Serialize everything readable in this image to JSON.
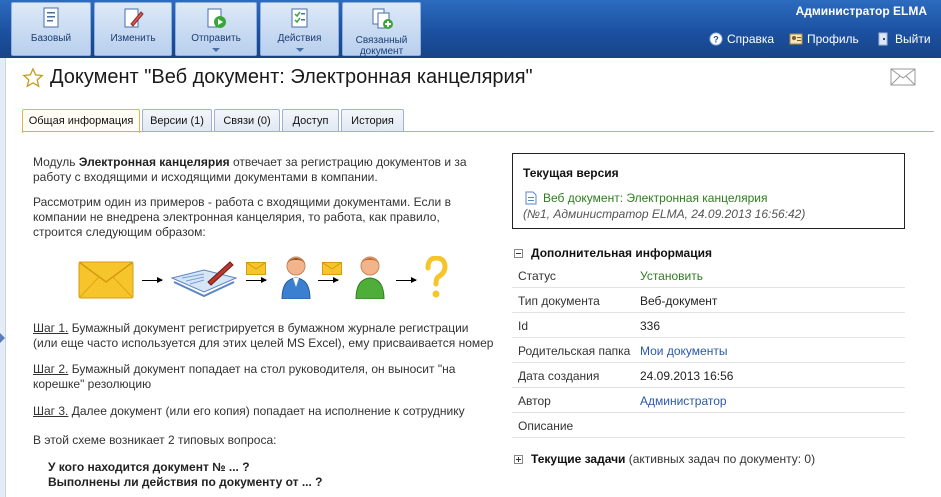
{
  "toolbar": {
    "buttons": [
      {
        "label": "Базовый",
        "icon": "base-document-icon"
      },
      {
        "label": "Изменить",
        "icon": "edit-icon"
      },
      {
        "label": "Отправить",
        "icon": "send-icon",
        "dropdown": true
      },
      {
        "label": "Действия",
        "icon": "actions-icon",
        "dropdown": true
      },
      {
        "label": "Связанный документ",
        "label_lines": [
          "Связанный",
          "документ"
        ],
        "icon": "linked-document-icon"
      }
    ],
    "user_name": "Администратор ELMA",
    "links": {
      "help": "Справка",
      "profile": "Профиль",
      "logout": "Выйти"
    }
  },
  "page": {
    "title": "Документ \"Веб документ: Электронная канцелярия\""
  },
  "tabs": [
    {
      "label": "Общая информация",
      "active": true
    },
    {
      "label": "Версии (1)"
    },
    {
      "label": "Связи (0)"
    },
    {
      "label": "Доступ"
    },
    {
      "label": "История"
    }
  ],
  "content": {
    "p1_prefix": "Модуль ",
    "p1_bold": "Электронная канцелярия",
    "p1_rest_line1": " отвечает за регистрацию документов и за",
    "p1_line2": "работу с входящими и исходящими документами в компании.",
    "p2_line1": "Рассмотрим один из примеров - работа с входящими документами. Если в",
    "p2_line2": "компании не внедрена электронная канцелярия, то работа, как правило,",
    "p2_line3": "строится следующим образом:",
    "step1_label": "Шаг 1.",
    "step1_line1": " Бумажный документ регистрируется в бумажном журнале регистрации",
    "step1_line2": "(или еще часто используется для этих целей MS Excel), ему присваивается номер",
    "step2_label": "Шаг 2.",
    "step2_line1": " Бумажный документ попадает на стол руководителя, он выносит \"на",
    "step2_line2": "корешке\" резолюцию",
    "step3_label": "Шаг 3.",
    "step3_line1": " Далее документ (или его копия) попадает на исполнение к сотруднику",
    "p3": "В этой схеме возникает 2 типовых вопроса:",
    "q1": "У кого находится документ № ... ?",
    "q2": "Выполнены ли действия по документу от ... ?"
  },
  "current_version": {
    "title": "Текущая версия",
    "link": "Веб документ: Электронная канцелярия",
    "meta": "(№1, Администратор ELMA, 24.09.2013 16:56:42)"
  },
  "additional_info": {
    "title": "Дополнительная информация",
    "rows": [
      {
        "key": "Статус",
        "value": "Установить"
      },
      {
        "key": "Тип документа",
        "value": "Веб-документ"
      },
      {
        "key": "Id",
        "value": "336"
      },
      {
        "key": "Родительская папка",
        "value": "Мои документы"
      },
      {
        "key": "Дата создания",
        "value": "24.09.2013 16:56"
      },
      {
        "key": "Автор",
        "value": "Администратор"
      },
      {
        "key": "Описание",
        "value": ""
      }
    ]
  },
  "tasks": {
    "title": "Текущие задачи",
    "note": " (активных задач по документу: 0)"
  },
  "colors": {
    "toolbar": "#1b4f9e",
    "link": "#2b58a8",
    "green_link": "#2e7d1f"
  }
}
